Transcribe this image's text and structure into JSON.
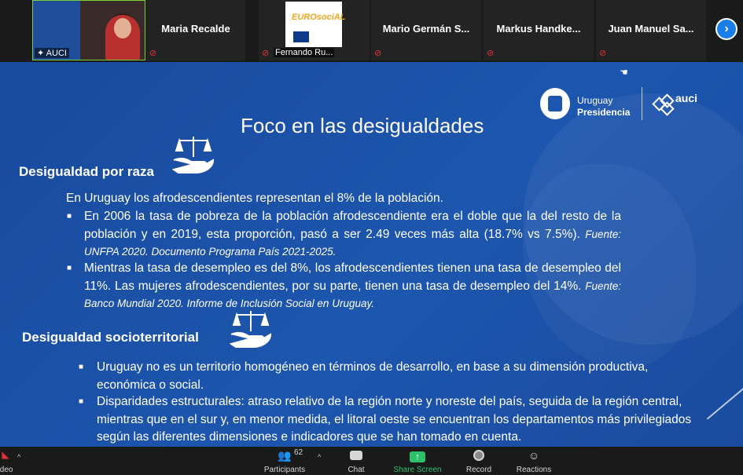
{
  "participants": {
    "tiles": [
      {
        "name": "AUCI",
        "role": "video"
      },
      {
        "name": "Maria Recalde"
      },
      {
        "name": "Fernando Ru..."
      },
      {
        "name": "Mario Germán S..."
      },
      {
        "name": "Markus  Handke..."
      },
      {
        "name": "Juan Manuel Sa..."
      }
    ],
    "next_icon": "›"
  },
  "slide": {
    "title": "Foco en las desigualdades",
    "logo_uruguay_line1": "Uruguay",
    "logo_uruguay_line2": "Presidencia",
    "logo_auci": "auci",
    "logo_eurosocial": "EUROsociAL",
    "section1": {
      "title": "Desigualdad por raza",
      "intro": "En Uruguay los afrodescendientes representan el 8% de la población.",
      "bullets": [
        {
          "text": "En 2006 la tasa de pobreza de la población afrodescendiente era el doble que la del resto de la población y en 2019, esta proporción, pasó a ser 2.49 veces más alta (18.7% vs 7.5%). ",
          "source": "Fuente: UNFPA 2020. Documento Programa País 2021-2025."
        },
        {
          "text": "Mientras la tasa de desempleo es del 8%, los afrodescendientes tienen una tasa de desempleo del 11%. Las mujeres afrodescendientes, por su parte, tienen una tasa de desempleo del 14%. ",
          "source": "Fuente: Banco Mundial 2020. Informe de Inclusión Social en Uruguay."
        }
      ]
    },
    "section2": {
      "title": "Desigualdad socioterritorial",
      "bullets": [
        {
          "text": "Uruguay no es un territorio homogéneo en términos de desarrollo, en base a su dimensión productiva, económica o social."
        },
        {
          "text": "Disparidades estructurales:  atraso relativo de la región norte y noreste del país, seguida de la región central, mientras que en el sur y, en menor medida, el litoral oeste se encuentran los departamentos más privilegiados según las diferentes dimensiones e indicadores que se han tomado en cuenta."
        }
      ]
    }
  },
  "toolbar": {
    "video_label": "ideo",
    "participants_label": "Participants",
    "participants_count": "62",
    "chat_label": "Chat",
    "share_label": "Share Screen",
    "record_label": "Record",
    "reactions_label": "Reactions"
  },
  "colors": {
    "slide_bg": "#1d56ae",
    "share_green": "#2ec16c",
    "mute_red": "#e0313a",
    "active_speaker": "#7fd03a"
  }
}
